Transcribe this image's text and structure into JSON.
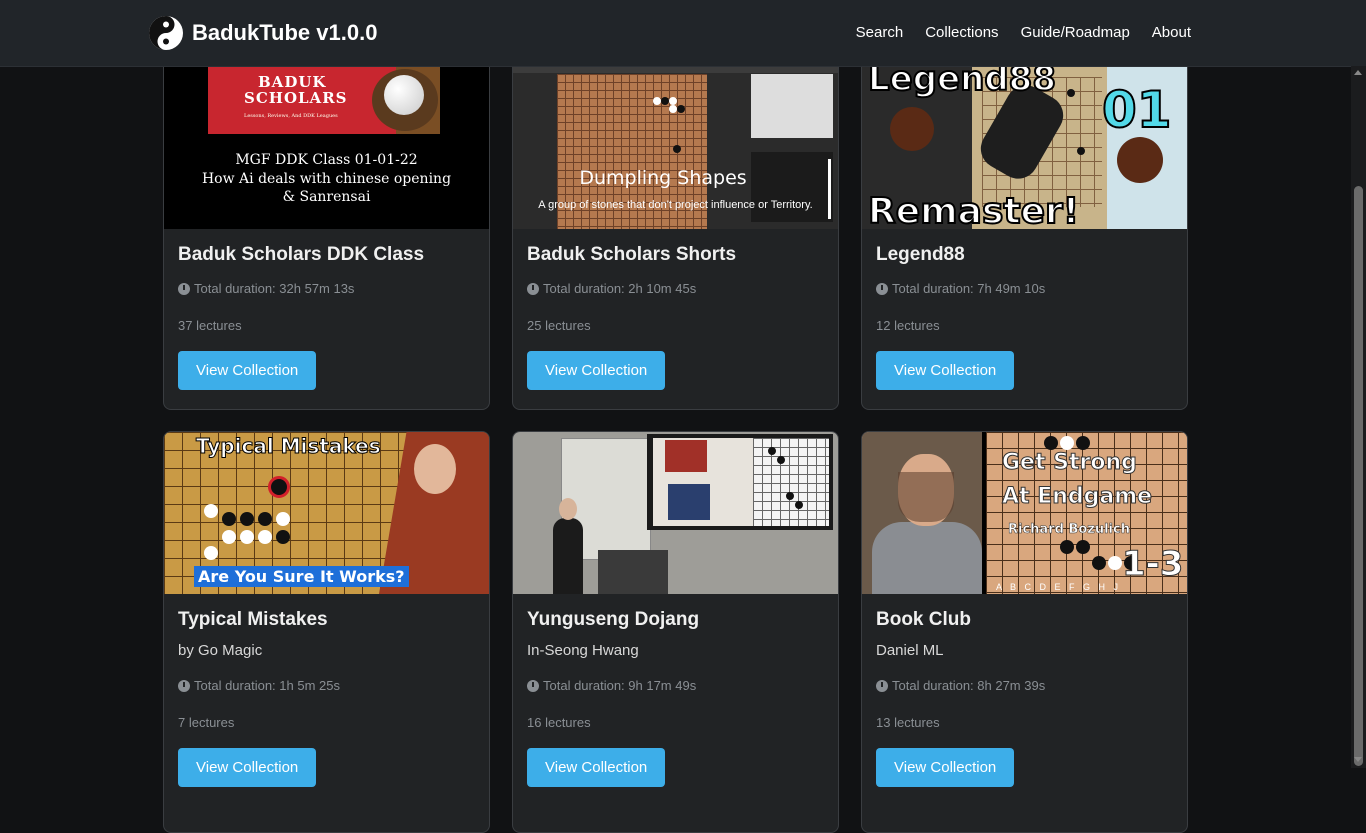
{
  "app": {
    "name": "BadukTube v1.0.0"
  },
  "nav": {
    "items": [
      "Search",
      "Collections",
      "Guide/Roadmap",
      "About"
    ]
  },
  "cards": [
    {
      "title": "Baduk Scholars DDK Class",
      "author": "",
      "duration": "Total duration: 32h 57m 13s",
      "lectures": "37 lectures",
      "button": "View Collection",
      "thumb": {
        "banner_line1": "BADUK",
        "banner_line2": "SCHOLARS",
        "banner_sub": "Lessons, Reviews, And DDK Leagues",
        "caption1": "MGF DDK Class 01-01-22",
        "caption2": "How Ai deals with chinese opening",
        "caption3": "& Sanrensai"
      }
    },
    {
      "title": "Baduk Scholars Shorts",
      "author": "",
      "duration": "Total duration: 2h 10m 45s",
      "lectures": "25 lectures",
      "button": "View Collection",
      "thumb": {
        "caption1": "Dumpling Shapes",
        "caption2": "A group of stones that don't project influence or Territory."
      }
    },
    {
      "title": "Legend88",
      "author": "",
      "duration": "Total duration: 7h 49m 10s",
      "lectures": "12 lectures",
      "button": "View Collection",
      "thumb": {
        "top": "Legend88",
        "number": "01",
        "bottom": "Remaster!"
      }
    },
    {
      "title": "Typical Mistakes",
      "author": "by Go Magic",
      "duration": "Total duration: 1h 5m 25s",
      "lectures": "7 lectures",
      "button": "View Collection",
      "thumb": {
        "top": "Typical Mistakes",
        "bottom": "Are You Sure It Works?"
      }
    },
    {
      "title": "Yunguseng Dojang",
      "author": "In-Seong Hwang",
      "duration": "Total duration: 9h 17m 49s",
      "lectures": "16 lectures",
      "button": "View Collection",
      "thumb": {}
    },
    {
      "title": "Book Club",
      "author": "Daniel ML",
      "duration": "Total duration: 8h 27m 39s",
      "lectures": "13 lectures",
      "button": "View Collection",
      "thumb": {
        "line1": "Get Strong",
        "line2": "At Endgame",
        "line3": "Richard Bozulich",
        "line4": "1-3",
        "letters": "A B C D E F G H J"
      }
    }
  ]
}
